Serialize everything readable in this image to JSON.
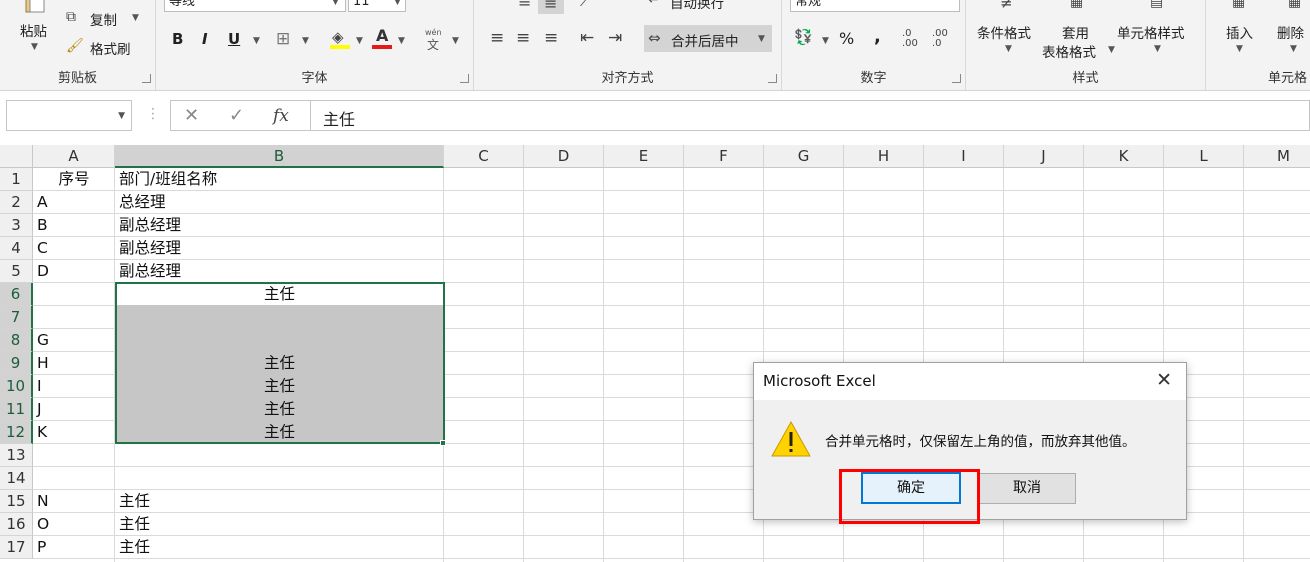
{
  "ribbon": {
    "clipboard": {
      "paste_label": "粘贴",
      "copy_label": "复制",
      "format_painter_label": "格式刷",
      "group_label": "剪贴板"
    },
    "font": {
      "font_name": "等线",
      "font_size": "11",
      "bold": "B",
      "italic": "I",
      "underline": "U",
      "group_label": "字体",
      "pinyin_glyph": "wén"
    },
    "alignment": {
      "wrap_label": "自动换行",
      "merge_label": "合并后居中",
      "group_label": "对齐方式"
    },
    "number": {
      "format_value": "常规",
      "percent": "%",
      "comma": ",",
      "group_label": "数字"
    },
    "styles": {
      "conditional_label": "条件格式",
      "table_label_1": "套用",
      "table_label_2": "表格格式",
      "cell_styles_label": "单元格样式",
      "group_label": "样式"
    },
    "cells": {
      "insert_label": "插入",
      "delete_label": "删除",
      "group_label": "单元格"
    }
  },
  "formula_bar": {
    "name_box": "",
    "cancel": "✕",
    "enter": "✓",
    "fx": "fx",
    "value": "主任"
  },
  "grid": {
    "columns": [
      "A",
      "B",
      "C",
      "D",
      "E",
      "F",
      "G",
      "H",
      "I",
      "J",
      "K",
      "L",
      "M"
    ],
    "rows": [
      "1",
      "2",
      "3",
      "4",
      "5",
      "6",
      "7",
      "8",
      "9",
      "10",
      "11",
      "12",
      "13",
      "14",
      "15",
      "16",
      "17"
    ],
    "cells": {
      "A1": "序号",
      "B1": "部门/班组名称",
      "A2": "A",
      "B2": "总经理",
      "A3": "B",
      "B3": "副总经理",
      "A4": "C",
      "B4": "副总经理",
      "A5": "D",
      "B5": "副总经理",
      "B6": "主任",
      "A8": "G",
      "A9": "H",
      "B9": "主任",
      "A10": "I",
      "B10": "主任",
      "A11": "J",
      "B11": "主任",
      "A12": "K",
      "B12": "主任",
      "A15": "N",
      "B15": "主任",
      "A16": "O",
      "B16": "主任",
      "A17": "P",
      "B17": "主任"
    }
  },
  "dialog": {
    "title": "Microsoft Excel",
    "close": "✕",
    "message": "合并单元格时，仅保留左上角的值，而放弃其他值。",
    "ok_label": "确定",
    "cancel_label": "取消"
  },
  "colors": {
    "excel_green": "#217346",
    "highlight_red": "#ff0000",
    "selection_gray": "#c6c6c6"
  }
}
